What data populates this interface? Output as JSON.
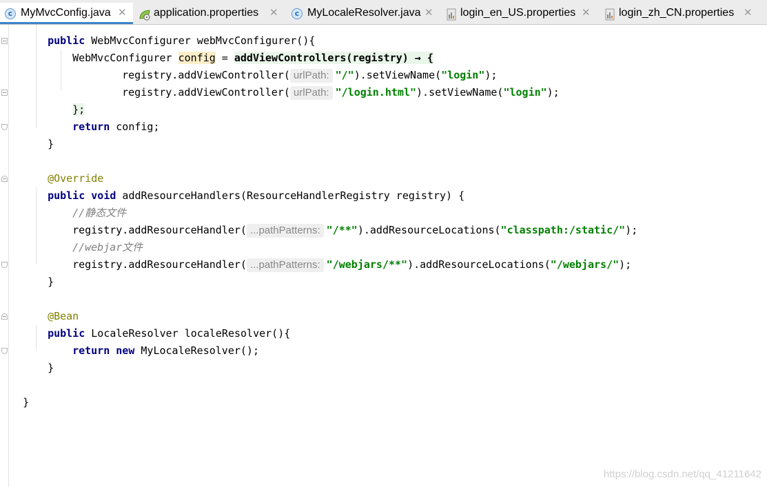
{
  "tabs": [
    {
      "label": "MyMvcConfig.java",
      "icon": "java-class-icon",
      "active": true
    },
    {
      "label": "application.properties",
      "icon": "spring-leaf-icon",
      "active": false
    },
    {
      "label": "MyLocaleResolver.java",
      "icon": "java-class-icon",
      "active": false
    },
    {
      "label": "login_en_US.properties",
      "icon": "properties-file-icon",
      "active": false
    },
    {
      "label": "login_zh_CN.properties",
      "icon": "properties-file-icon",
      "active": false
    }
  ],
  "close_glyph": "✕",
  "class_icon_letter": "c",
  "code": {
    "l0_kw": "public",
    "l0_rest": " WebMvcConfigurer webMvcConfigurer(){",
    "l1_type": "WebMvcConfigurer ",
    "l1_var": "config",
    "l1_eq": " = ",
    "l1_call": "addViewControllers(registry) → {",
    "l2_pre": "registry.addViewController(",
    "l2_hint": "urlPath:",
    "l2_arg": "\"/\"",
    "l2_mid": ").setViewName(",
    "l2_view": "\"login\"",
    "l2_end": ");",
    "l3_pre": "registry.addViewController(",
    "l3_hint": "urlPath:",
    "l3_arg": "\"/login.html\"",
    "l3_mid": ").setViewName(",
    "l3_view": "\"login\"",
    "l3_end": ");",
    "l4": "};",
    "l5_kw": "return",
    "l5_rest": " config;",
    "l6": "}",
    "l8": "@Override",
    "l9_kw1": "public",
    "l9_kw2": "void",
    "l9_rest": " addResourceHandlers(ResourceHandlerRegistry registry) {",
    "l10": "//静态文件",
    "l11_pre": "registry.addResourceHandler(",
    "l11_hint": "...pathPatterns:",
    "l11_arg": "\"/**\"",
    "l11_mid": ").addResourceLocations(",
    "l11_loc": "\"classpath:/static/\"",
    "l11_end": ");",
    "l12": "//webjar文件",
    "l13_pre": "registry.addResourceHandler(",
    "l13_hint": "...pathPatterns:",
    "l13_arg": "\"/webjars/**\"",
    "l13_mid": ").addResourceLocations(",
    "l13_loc": "\"/webjars/\"",
    "l13_end": ");",
    "l14": "}",
    "l16": "@Bean",
    "l17_kw": "public",
    "l17_rest": " LocaleResolver localeResolver(){",
    "l18_kw1": "return",
    "l18_kw2": "new",
    "l18_rest": " MyLocaleResolver();",
    "l19": "}",
    "l21": "}"
  },
  "watermark": "https://blog.csdn.net/qq_41211642"
}
